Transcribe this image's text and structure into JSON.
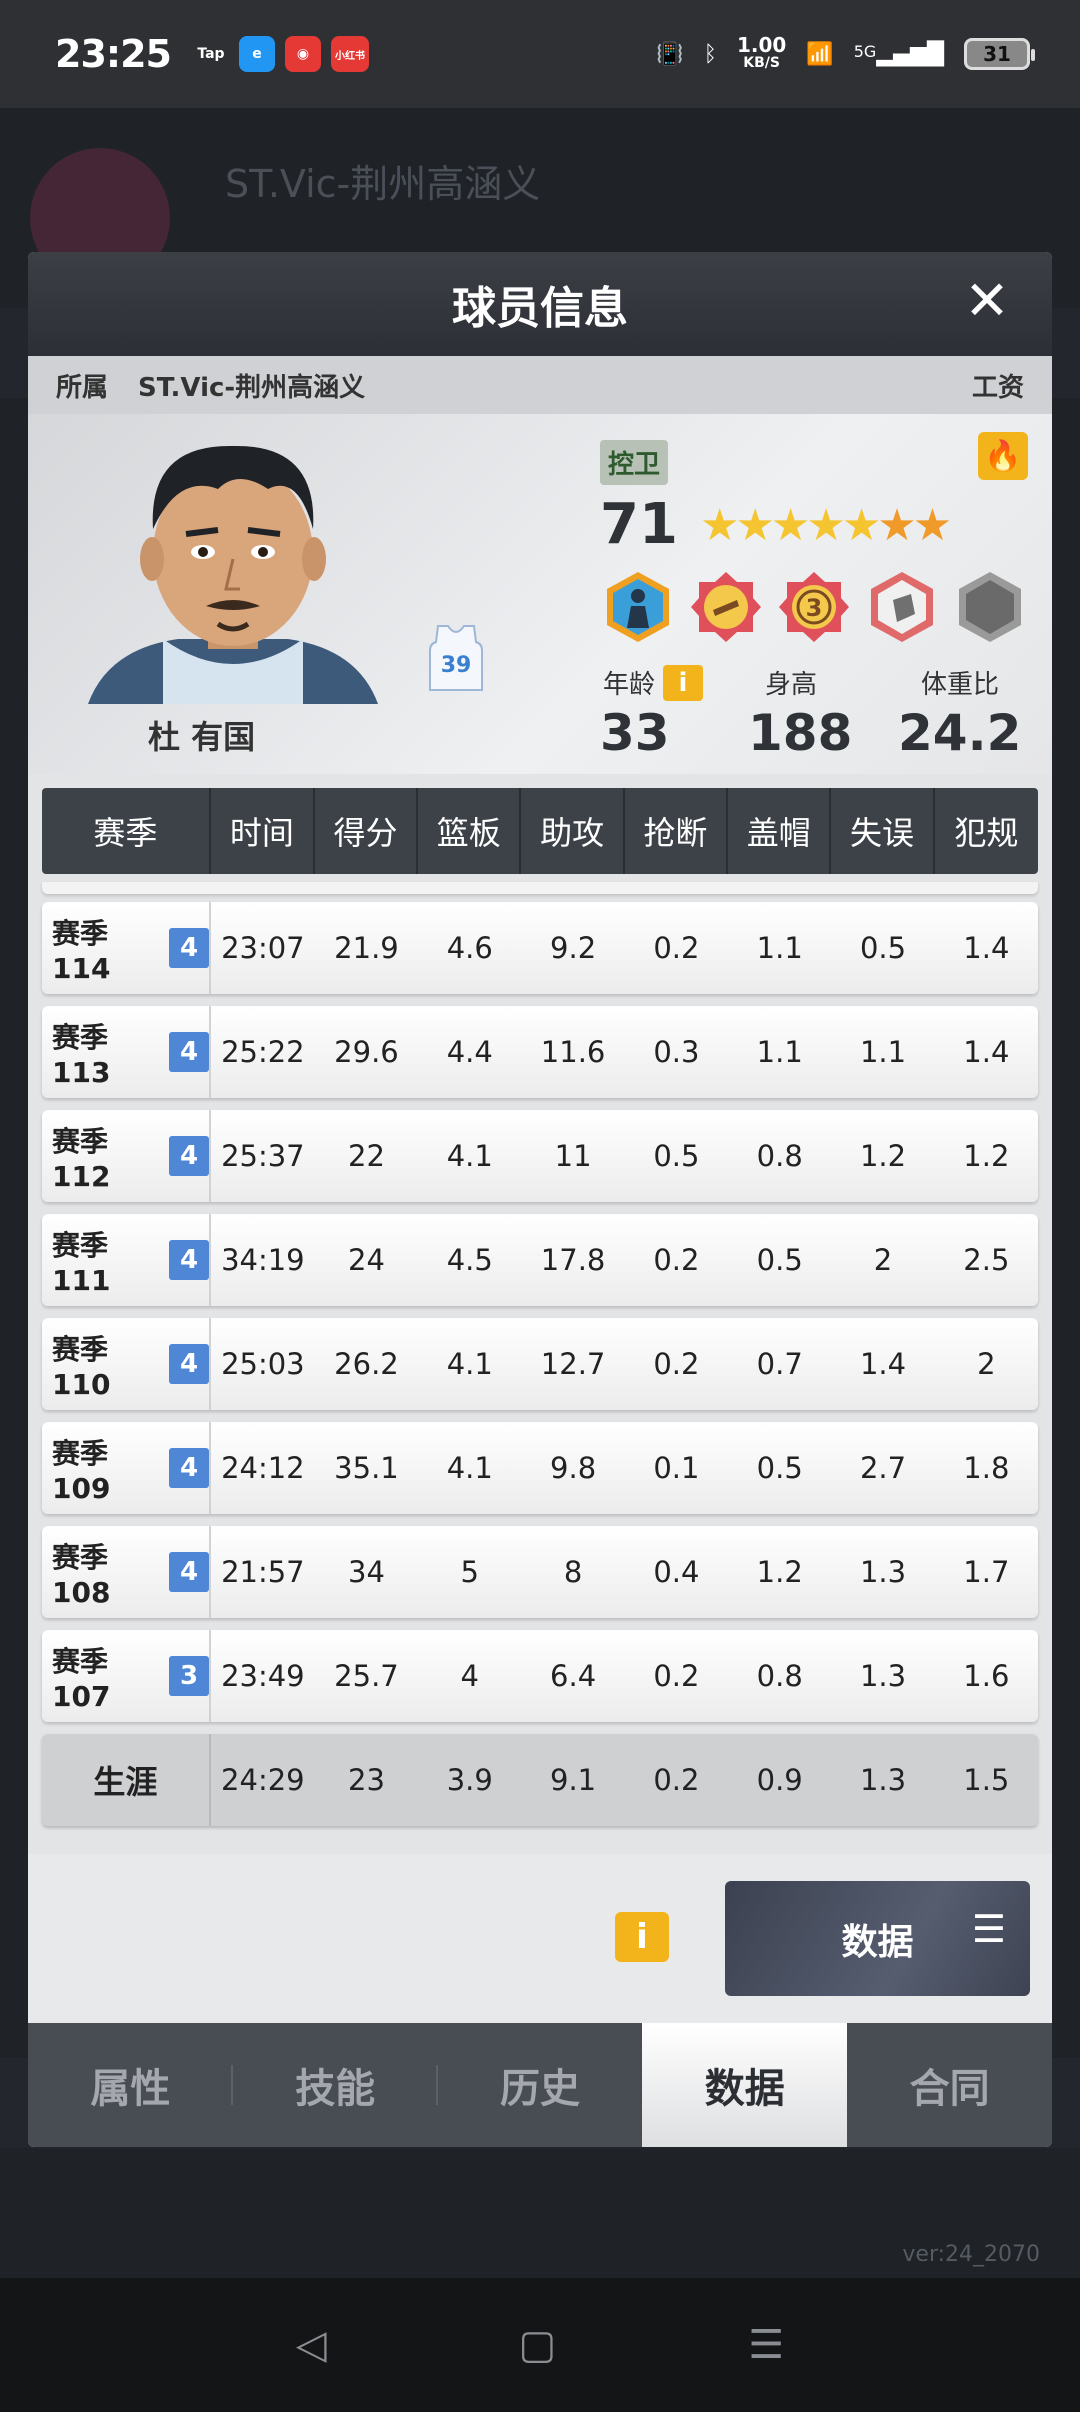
{
  "status_bar": {
    "time": "23:25",
    "apps": [
      {
        "name": "tap-icon",
        "label": "Tap",
        "color": "#2e3034"
      },
      {
        "name": "ctrip-icon",
        "label": "e",
        "color": "#2196f3"
      },
      {
        "name": "app-red-icon",
        "label": "◉",
        "color": "#e53935"
      },
      {
        "name": "xiaohongshu-icon",
        "label": "小红书",
        "color": "#e53935"
      }
    ],
    "net_speed": "1.00",
    "net_unit": "KB/S",
    "signal_label": "5G",
    "battery": "31"
  },
  "background": {
    "title": "ST.Vic-荆州高涵义",
    "version": "ver:24_2070"
  },
  "modal": {
    "title": "球员信息",
    "close": "✕",
    "team_label": "所属",
    "team_name": "ST.Vic-荆州高涵义",
    "salary_label": "工资"
  },
  "player": {
    "name": "杜 有国",
    "jersey_number": "39",
    "position": "控卫",
    "rating": "71",
    "stars_gold": 5,
    "stars_orange": 2,
    "age_label": "年龄",
    "height_label": "身高",
    "weight_ratio_label": "体重比",
    "age": "33",
    "height": "188",
    "weight_ratio": "24.2",
    "info_icon_label": "i",
    "fire_icon": "🔥"
  },
  "table": {
    "headers": [
      "赛季",
      "时间",
      "得分",
      "篮板",
      "助攻",
      "抢断",
      "盖帽",
      "失误",
      "犯规"
    ],
    "rows": [
      {
        "season": "赛季114",
        "tier": "4",
        "values": [
          "23:07",
          "21.9",
          "4.6",
          "9.2",
          "0.2",
          "1.1",
          "0.5",
          "1.4"
        ]
      },
      {
        "season": "赛季113",
        "tier": "4",
        "values": [
          "25:22",
          "29.6",
          "4.4",
          "11.6",
          "0.3",
          "1.1",
          "1.1",
          "1.4"
        ]
      },
      {
        "season": "赛季112",
        "tier": "4",
        "values": [
          "25:37",
          "22",
          "4.1",
          "11",
          "0.5",
          "0.8",
          "1.2",
          "1.2"
        ]
      },
      {
        "season": "赛季111",
        "tier": "4",
        "values": [
          "34:19",
          "24",
          "4.5",
          "17.8",
          "0.2",
          "0.5",
          "2",
          "2.5"
        ]
      },
      {
        "season": "赛季110",
        "tier": "4",
        "values": [
          "25:03",
          "26.2",
          "4.1",
          "12.7",
          "0.2",
          "0.7",
          "1.4",
          "2"
        ]
      },
      {
        "season": "赛季109",
        "tier": "4",
        "values": [
          "24:12",
          "35.1",
          "4.1",
          "9.8",
          "0.1",
          "0.5",
          "2.7",
          "1.8"
        ]
      },
      {
        "season": "赛季108",
        "tier": "4",
        "values": [
          "21:57",
          "34",
          "5",
          "8",
          "0.4",
          "1.2",
          "1.3",
          "1.7"
        ]
      },
      {
        "season": "赛季107",
        "tier": "3",
        "values": [
          "23:49",
          "25.7",
          "4",
          "6.4",
          "0.2",
          "0.8",
          "1.3",
          "1.6"
        ]
      }
    ],
    "career": {
      "label": "生涯",
      "values": [
        "24:29",
        "23",
        "3.9",
        "9.1",
        "0.2",
        "0.9",
        "1.3",
        "1.5"
      ]
    }
  },
  "actions": {
    "info": "i",
    "data_button": "数据",
    "menu_icon": "☰"
  },
  "tabs": [
    {
      "label": "属性",
      "active": false
    },
    {
      "label": "技能",
      "active": false
    },
    {
      "label": "历史",
      "active": false
    },
    {
      "label": "数据",
      "active": true
    },
    {
      "label": "合同",
      "active": false
    }
  ],
  "nav_bar": {
    "back": "◁",
    "home": "▢",
    "menu": "☰"
  },
  "colors": {
    "accent_gold": "#f3b31a",
    "tier_blue": "#4f86d6",
    "header_dark": "#3d4249"
  }
}
